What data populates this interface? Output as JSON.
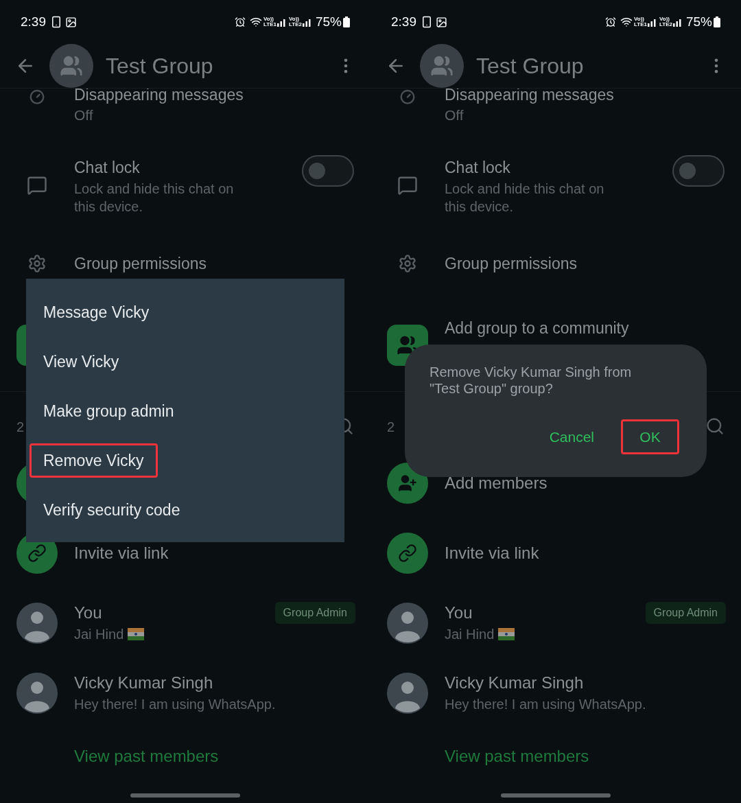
{
  "panels": [
    {
      "status_bar": {
        "time": "2:39",
        "sims": [
          {
            "top": "Vo))",
            "bottom": "LTE1"
          },
          {
            "top": "Vo))",
            "bottom": "LTE2"
          }
        ],
        "battery": "75%"
      },
      "header": {
        "title": "Test Group"
      },
      "disappearing": {
        "title": "Disappearing messages",
        "subtitle": "Off"
      },
      "chat_lock": {
        "title": "Chat lock",
        "subtitle": "Lock and hide this chat on this device.",
        "on": false
      },
      "group_permissions": {
        "title": "Group permissions"
      },
      "members_header": {
        "text": "2"
      },
      "actions": [
        {
          "kind": "add"
        },
        {
          "kind": "link",
          "label": "Invite via link"
        }
      ],
      "members": [
        {
          "name": "You",
          "about": "Jai Hind",
          "flag": true,
          "badge": "Group Admin"
        },
        {
          "name": "Vicky Kumar Singh",
          "about": "Hey there! I am using WhatsApp.",
          "flag": false
        }
      ],
      "view_past_members": "View past members",
      "overlay": {
        "kind": "menu",
        "items": [
          {
            "label": "Message Vicky",
            "highlighted": false
          },
          {
            "label": "View Vicky",
            "highlighted": false
          },
          {
            "label": "Make group admin",
            "highlighted": false
          },
          {
            "label": "Remove Vicky",
            "highlighted": true
          },
          {
            "label": "Verify security code",
            "highlighted": false
          }
        ]
      }
    },
    {
      "status_bar": {
        "time": "2:39",
        "sims": [
          {
            "top": "Vo))",
            "bottom": "LTE1"
          },
          {
            "top": "Vo))",
            "bottom": "LTE2"
          }
        ],
        "battery": "75%"
      },
      "header": {
        "title": "Test Group"
      },
      "disappearing": {
        "title": "Disappearing messages",
        "subtitle": "Off"
      },
      "chat_lock": {
        "title": "Chat lock",
        "subtitle": "Lock and hide this chat on this device.",
        "on": false
      },
      "group_permissions": {
        "title": "Group permissions"
      },
      "community": {
        "title": "Add group to a community"
      },
      "members_header": {
        "text": "2"
      },
      "actions": [
        {
          "kind": "add",
          "label": "Add members"
        },
        {
          "kind": "link",
          "label": "Invite via link"
        }
      ],
      "members": [
        {
          "name": "You",
          "about": "Jai Hind",
          "flag": true,
          "badge": "Group Admin"
        },
        {
          "name": "Vicky Kumar Singh",
          "about": "Hey there! I am using WhatsApp.",
          "flag": false
        }
      ],
      "view_past_members": "View past members",
      "overlay": {
        "kind": "dialog",
        "message": "Remove Vicky Kumar Singh from \"Test Group\" group?",
        "buttons": [
          {
            "label": "Cancel",
            "highlighted": false
          },
          {
            "label": "OK",
            "highlighted": true
          }
        ]
      }
    }
  ]
}
